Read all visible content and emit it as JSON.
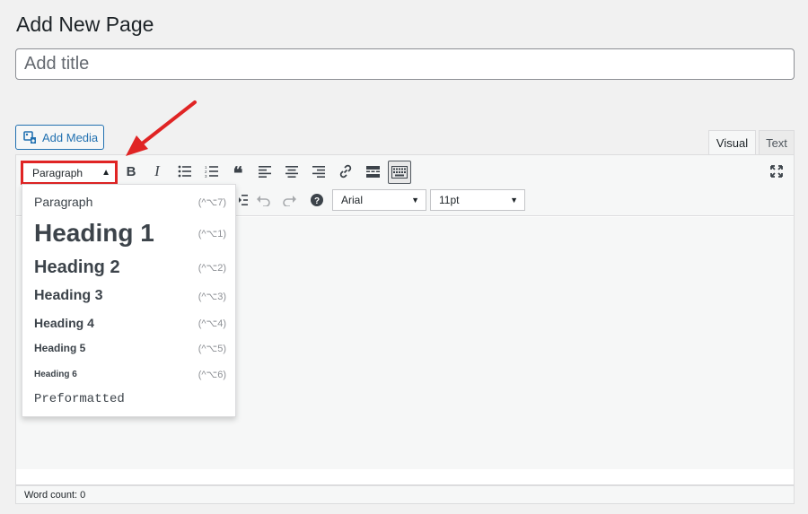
{
  "page": {
    "title": "Add New Page"
  },
  "title_field": {
    "placeholder": "Add title",
    "value": ""
  },
  "media": {
    "add_media_label": "Add Media"
  },
  "tabs": {
    "visual": "Visual",
    "text": "Text"
  },
  "toolbar": {
    "format_selected": "Paragraph",
    "font_family": "Arial",
    "font_size": "11pt"
  },
  "format_menu": {
    "items": [
      {
        "label": "Paragraph",
        "shortcut": "(^⌥7)"
      },
      {
        "label": "Heading 1",
        "shortcut": "(^⌥1)"
      },
      {
        "label": "Heading 2",
        "shortcut": "(^⌥2)"
      },
      {
        "label": "Heading 3",
        "shortcut": "(^⌥3)"
      },
      {
        "label": "Heading 4",
        "shortcut": "(^⌥4)"
      },
      {
        "label": "Heading 5",
        "shortcut": "(^⌥5)"
      },
      {
        "label": "Heading 6",
        "shortcut": "(^⌥6)"
      },
      {
        "label": "Preformatted",
        "shortcut": ""
      }
    ]
  },
  "status": {
    "word_count": "Word count: 0"
  },
  "colors": {
    "accent": "#2271b1",
    "highlight": "#e02424"
  },
  "icons": [
    "add-media-icon",
    "bold-icon",
    "italic-icon",
    "bulleted-list-icon",
    "numbered-list-icon",
    "blockquote-icon",
    "align-left-icon",
    "align-center-icon",
    "align-right-icon",
    "link-icon",
    "read-more-icon",
    "toolbar-toggle-icon",
    "fullscreen-icon",
    "indent-icon",
    "undo-icon",
    "redo-icon",
    "help-icon",
    "annotation-arrow"
  ]
}
